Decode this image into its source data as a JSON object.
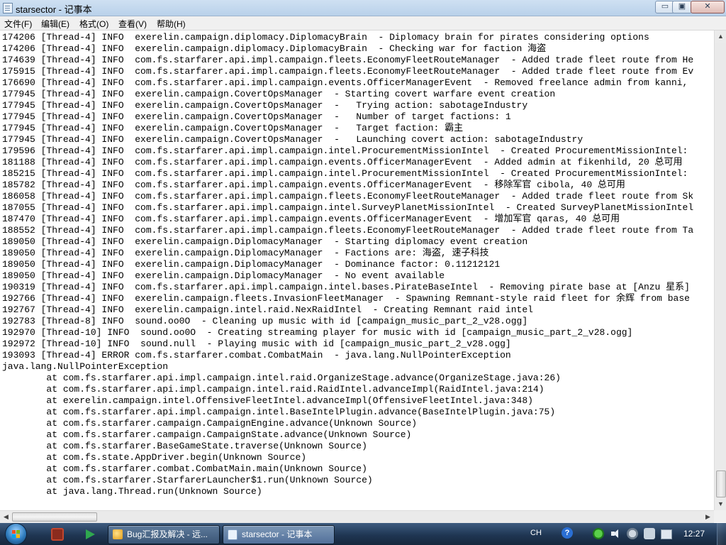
{
  "window": {
    "title": "starsector - 记事本",
    "min_label": "▭",
    "max_label": "▣",
    "close_label": "✕"
  },
  "menu": [
    "文件(F)",
    "编辑(E)",
    "格式(O)",
    "查看(V)",
    "帮助(H)"
  ],
  "log_lines": [
    "174206 [Thread-4] INFO  exerelin.campaign.diplomacy.DiplomacyBrain  - Diplomacy brain for pirates considering options",
    "174206 [Thread-4] INFO  exerelin.campaign.diplomacy.DiplomacyBrain  - Checking war for faction 海盗",
    "174639 [Thread-4] INFO  com.fs.starfarer.api.impl.campaign.fleets.EconomyFleetRouteManager  - Added trade fleet route from He",
    "175915 [Thread-4] INFO  com.fs.starfarer.api.impl.campaign.fleets.EconomyFleetRouteManager  - Added trade fleet route from Ev",
    "176690 [Thread-4] INFO  com.fs.starfarer.api.impl.campaign.events.OfficerManagerEvent  - Removed freelance admin from kanni,",
    "177945 [Thread-4] INFO  exerelin.campaign.CovertOpsManager  - Starting covert warfare event creation",
    "177945 [Thread-4] INFO  exerelin.campaign.CovertOpsManager  -   Trying action: sabotageIndustry",
    "177945 [Thread-4] INFO  exerelin.campaign.CovertOpsManager  -   Number of target factions: 1",
    "177945 [Thread-4] INFO  exerelin.campaign.CovertOpsManager  -   Target faction: 霸主",
    "177945 [Thread-4] INFO  exerelin.campaign.CovertOpsManager  -   Launching covert action: sabotageIndustry",
    "179596 [Thread-4] INFO  com.fs.starfarer.api.impl.campaign.intel.ProcurementMissionIntel  - Created ProcurementMissionIntel: ",
    "181188 [Thread-4] INFO  com.fs.starfarer.api.impl.campaign.events.OfficerManagerEvent  - Added admin at fikenhild, 20 总可用",
    "185215 [Thread-4] INFO  com.fs.starfarer.api.impl.campaign.intel.ProcurementMissionIntel  - Created ProcurementMissionIntel: ",
    "185782 [Thread-4] INFO  com.fs.starfarer.api.impl.campaign.events.OfficerManagerEvent  - 移除军官 cibola, 40 总可用",
    "186058 [Thread-4] INFO  com.fs.starfarer.api.impl.campaign.fleets.EconomyFleetRouteManager  - Added trade fleet route from Sk",
    "187055 [Thread-4] INFO  com.fs.starfarer.api.impl.campaign.intel.SurveyPlanetMissionIntel  - Created SurveyPlanetMissionIntel",
    "187470 [Thread-4] INFO  com.fs.starfarer.api.impl.campaign.events.OfficerManagerEvent  - 增加军官 qaras, 40 总可用",
    "188552 [Thread-4] INFO  com.fs.starfarer.api.impl.campaign.fleets.EconomyFleetRouteManager  - Added trade fleet route from Ta",
    "189050 [Thread-4] INFO  exerelin.campaign.DiplomacyManager  - Starting diplomacy event creation",
    "189050 [Thread-4] INFO  exerelin.campaign.DiplomacyManager  - Factions are: 海盗, 速子科技",
    "189050 [Thread-4] INFO  exerelin.campaign.DiplomacyManager  - Dominance factor: 0.11212121",
    "189050 [Thread-4] INFO  exerelin.campaign.DiplomacyManager  - No event available",
    "190319 [Thread-4] INFO  com.fs.starfarer.api.impl.campaign.intel.bases.PirateBaseIntel  - Removing pirate base at [Anzu 星系]",
    "192766 [Thread-4] INFO  exerelin.campaign.fleets.InvasionFleetManager  - Spawning Remnant-style raid fleet for 余辉 from base",
    "192767 [Thread-4] INFO  exerelin.campaign.intel.raid.NexRaidIntel  - Creating Remnant raid intel",
    "192783 [Thread-8] INFO  sound.oo0O  - Cleaning up music with id [campaign_music_part_2_v28.ogg]",
    "192970 [Thread-10] INFO  sound.oo0O  - Creating streaming player for music with id [campaign_music_part_2_v28.ogg]",
    "192972 [Thread-10] INFO  sound.null  - Playing music with id [campaign_music_part_2_v28.ogg]",
    "193093 [Thread-4] ERROR com.fs.starfarer.combat.CombatMain  - java.lang.NullPointerException",
    "java.lang.NullPointerException",
    "\tat com.fs.starfarer.api.impl.campaign.intel.raid.OrganizeStage.advance(OrganizeStage.java:26)",
    "\tat com.fs.starfarer.api.impl.campaign.intel.raid.RaidIntel.advanceImpl(RaidIntel.java:214)",
    "\tat exerelin.campaign.intel.OffensiveFleetIntel.advanceImpl(OffensiveFleetIntel.java:348)",
    "\tat com.fs.starfarer.api.impl.campaign.intel.BaseIntelPlugin.advance(BaseIntelPlugin.java:75)",
    "\tat com.fs.starfarer.campaign.CampaignEngine.advance(Unknown Source)",
    "\tat com.fs.starfarer.campaign.CampaignState.advance(Unknown Source)",
    "\tat com.fs.starfarer.BaseGameState.traverse(Unknown Source)",
    "\tat com.fs.state.AppDriver.begin(Unknown Source)",
    "\tat com.fs.starfarer.combat.CombatMain.main(Unknown Source)",
    "\tat com.fs.starfarer.StarfarerLauncher$1.run(Unknown Source)",
    "\tat java.lang.Thread.run(Unknown Source)"
  ],
  "scrollbar": {
    "up": "▲",
    "down": "▼",
    "left": "◀",
    "right": "▶"
  },
  "taskbar": {
    "tasks": [
      {
        "label": "Bug汇报及解决 - 远...",
        "icon": "browser-icon"
      },
      {
        "label": "starsector - 记事本",
        "icon": "notepad-icon"
      }
    ],
    "lang": "CH",
    "help": "?",
    "clock": "12:27"
  }
}
